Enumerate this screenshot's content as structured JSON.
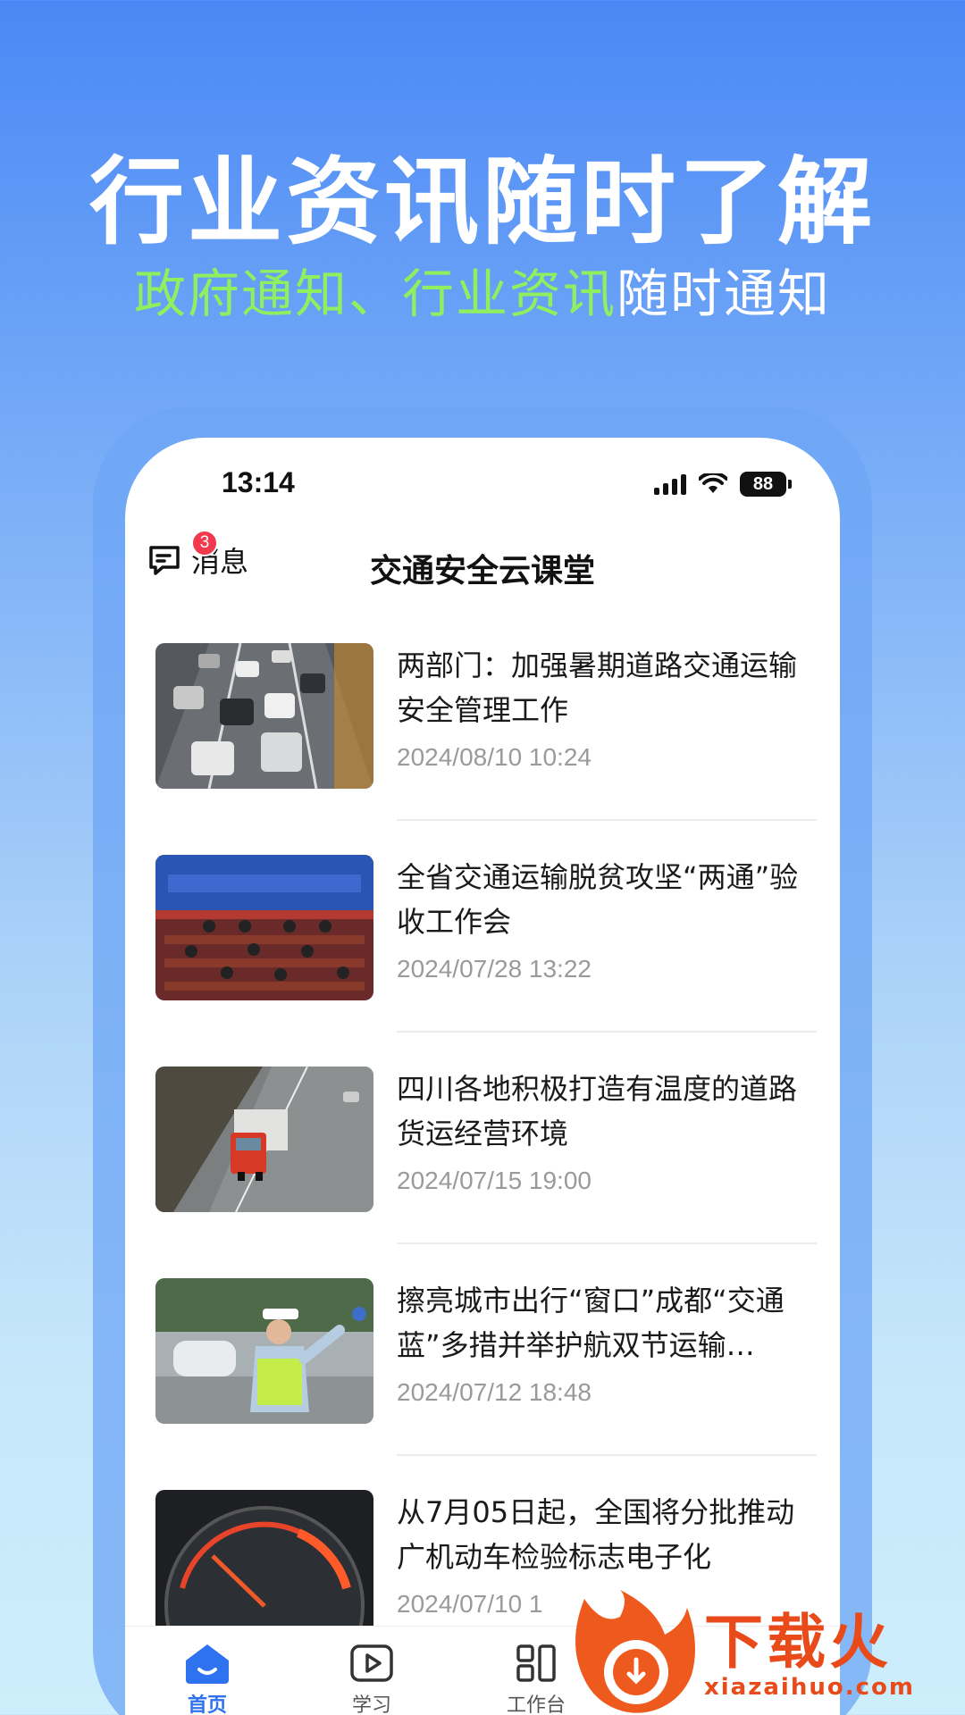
{
  "hero": {
    "title": "行业资讯随时了解",
    "subtitle_green": "政府通知、行业资讯",
    "subtitle_white": "随时通知"
  },
  "status_bar": {
    "time": "13:14",
    "battery": "88"
  },
  "header": {
    "messages_label": "消息",
    "messages_badge": "3",
    "title": "交通安全云课堂"
  },
  "news": [
    {
      "title": "两部门：加强暑期道路交通运输安全管理工作",
      "date": "2024/08/10 10:24",
      "image": "highway-cars-photo"
    },
    {
      "title": "全省交通运输脱贫攻坚“两通”验收工作会",
      "date": "2024/07/28 13:22",
      "image": "conference-meeting-photo"
    },
    {
      "title": "四川各地积极打造有温度的道路货运经营环境",
      "date": "2024/07/15 19:00",
      "image": "truck-road-photo"
    },
    {
      "title": "擦亮城市出行“窗口”成都“交通蓝”多措并举护航双节运输…",
      "date": "2024/07/12 18:48",
      "image": "traffic-police-photo"
    },
    {
      "title": "从7月05日起，全国将分批推动广机动车检验标志电子化",
      "date": "2024/07/10 1",
      "image": "speedometer-photo"
    }
  ],
  "tabbar": {
    "tabs": [
      {
        "label": "首页",
        "icon": "home-icon",
        "active": true
      },
      {
        "label": "学习",
        "icon": "play-icon",
        "active": false
      },
      {
        "label": "工作台",
        "icon": "grid-icon",
        "active": false
      }
    ]
  },
  "watermark": {
    "brand": "下载火",
    "url": "xiazaihuo.com"
  },
  "colors": {
    "accent": "#2e72f0",
    "subtitle_green": "#8ef05e",
    "badge": "#f2394e",
    "watermark": "#e84a1a"
  }
}
